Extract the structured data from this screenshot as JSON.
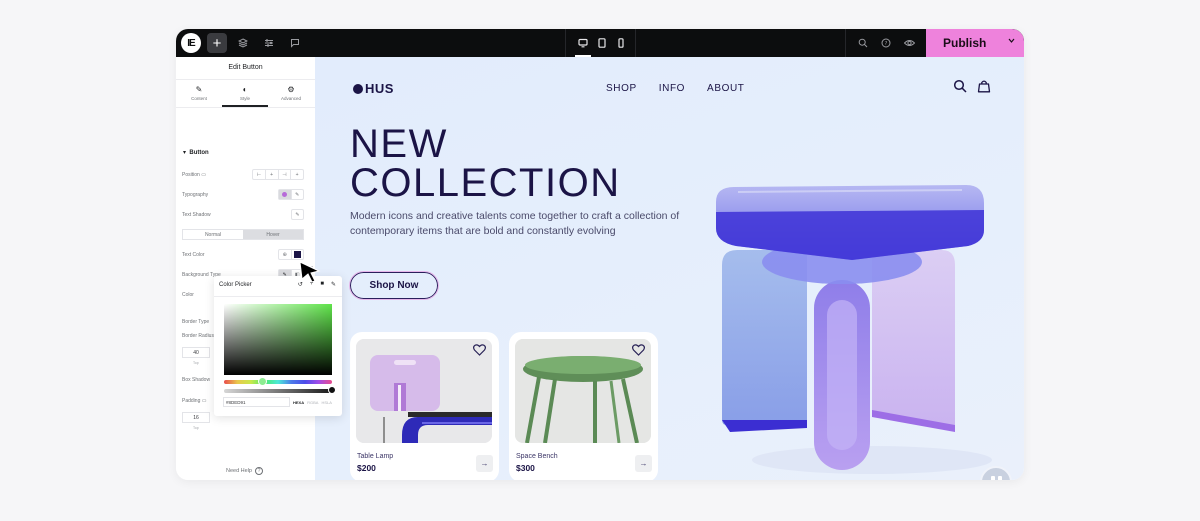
{
  "topbar": {
    "logo_glyph": "IE",
    "add_glyph": "+",
    "publish_label": "Publish",
    "colors": {
      "bar": "#0c0d0e",
      "publish": "#ee82dc"
    },
    "left_tools": [
      "add-element",
      "structure",
      "site-settings",
      "comments"
    ],
    "device_modes": [
      "desktop",
      "tablet",
      "mobile"
    ],
    "active_device": "desktop",
    "right_tools": [
      "search",
      "help",
      "preview"
    ]
  },
  "panel": {
    "title": "Edit Button",
    "tabs": [
      {
        "label": "Content",
        "icon": "✎"
      },
      {
        "label": "Style",
        "icon": "◐"
      },
      {
        "label": "Advanced",
        "icon": "⚙"
      }
    ],
    "active_tab": "Style",
    "section_title": "Button",
    "rows": {
      "position": "Position",
      "typography": "Typography",
      "text_shadow": "Text Shadow",
      "text_color": "Text Color",
      "background_type": "Background Type",
      "color": "Color",
      "border_type": "Border Type",
      "border_radius": "Border Radius",
      "box_shadow": "Box Shadow",
      "padding": "Padding"
    },
    "state_toggle": {
      "normal": "Normal",
      "hover": "Hover",
      "active": "Hover"
    },
    "border_radius_value": "40",
    "border_radius_sublabel": "Top",
    "padding_value": "16",
    "padding_sublabel": "Top",
    "text_color_swatch": "#1b1446",
    "need_help": "Need Help",
    "help_glyph": "?"
  },
  "color_picker": {
    "title": "Color Picker",
    "hex_value": "#8DED91",
    "modes": [
      "HEXA",
      "RGBA",
      "HSLA"
    ],
    "active_mode": "HEXA",
    "selected_color": "#8ded91"
  },
  "site": {
    "brand": "HUS",
    "nav": [
      "SHOP",
      "INFO",
      "ABOUT"
    ],
    "hero_title_line1": "NEW",
    "hero_title_line2": "COLLECTION",
    "hero_subtitle": "Modern icons and creative talents come together to craft a collection of contemporary items that are bold and constantly evolving",
    "cta": "Shop Now",
    "products": [
      {
        "name": "Table Lamp",
        "price": "$200"
      },
      {
        "name": "Space Bench",
        "price": "$300"
      }
    ],
    "colors": {
      "ink": "#1b1446",
      "background": "#e2ecfc"
    }
  }
}
